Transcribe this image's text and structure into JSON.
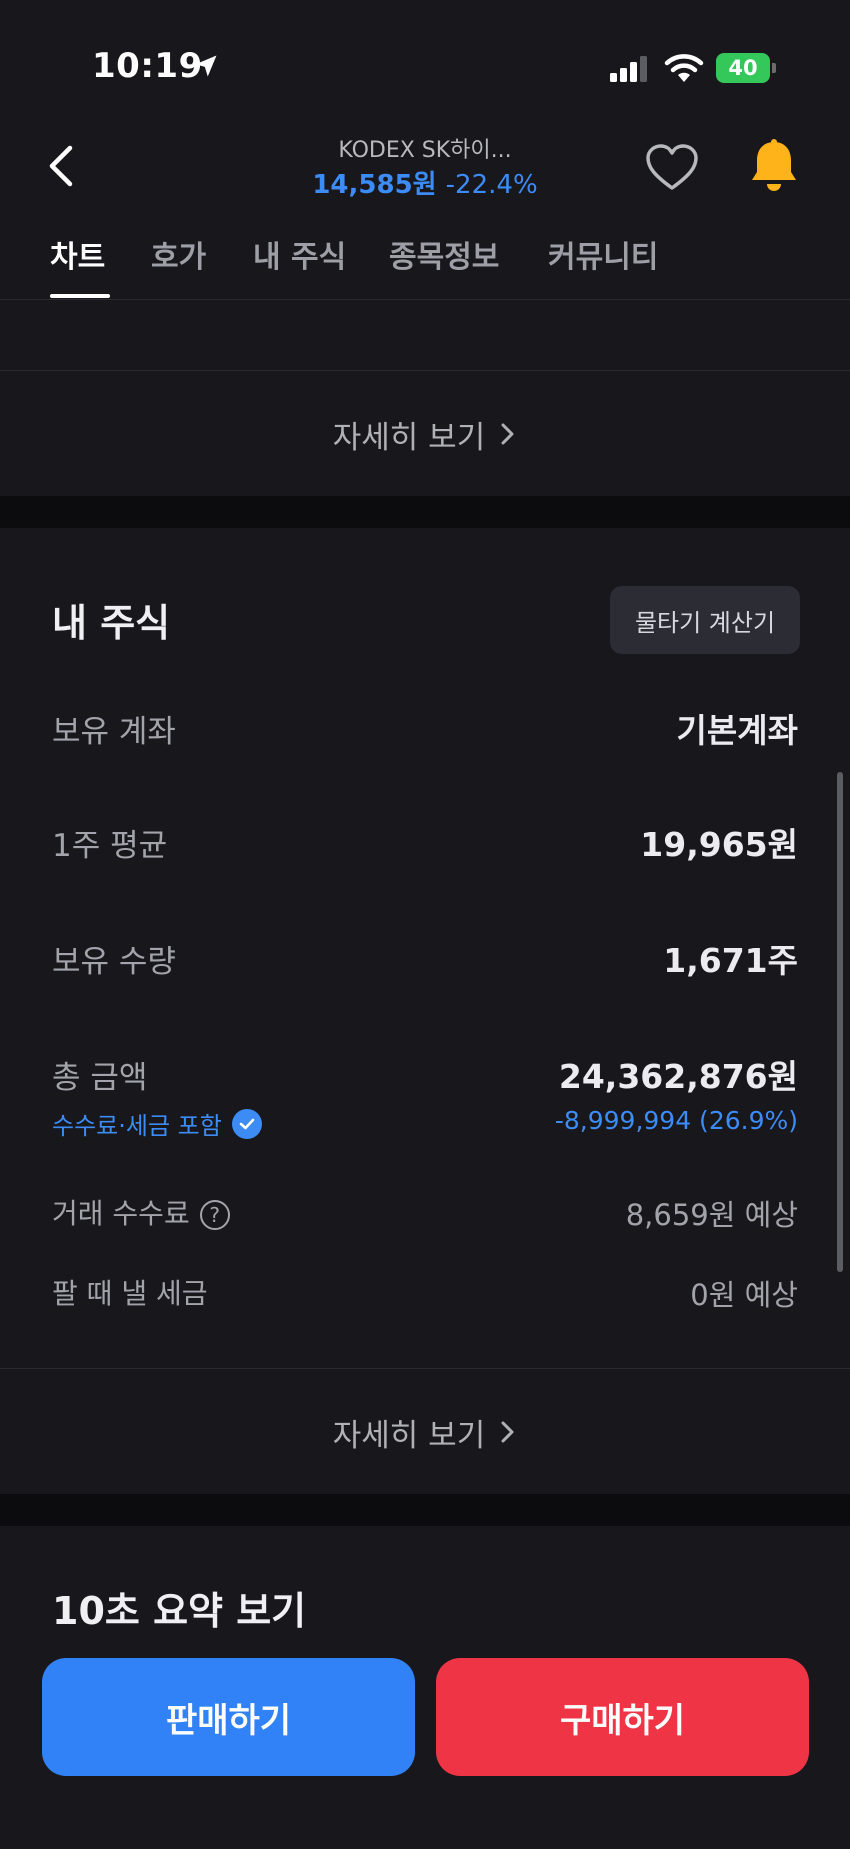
{
  "status_bar": {
    "time": "10:19",
    "battery": "40"
  },
  "header": {
    "stock_name": "KODEX SK하이...",
    "price": "14,585원",
    "change": "-22.4%"
  },
  "tabs": [
    "차트",
    "호가",
    "내 주식",
    "종목정보",
    "커뮤니티"
  ],
  "active_tab": 0,
  "upper_section": {
    "more_label": "자세히 보기"
  },
  "my_stock": {
    "title": "내 주식",
    "calc_button": "물타기 계산기",
    "account_label": "보유 계좌",
    "account_value": "기본계좌",
    "avg_label": "1주 평균",
    "avg_value": "19,965원",
    "qty_label": "보유 수량",
    "qty_value": "1,671주",
    "total_label": "총 금액",
    "total_value": "24,362,876원",
    "fee_tag": "수수료·세금 포함",
    "pl_value": "-8,999,994 (26.9%)",
    "fee_label": "거래 수수료",
    "fee_value": "8,659원 예상",
    "tax_label": "팔 때 낼 세금",
    "tax_value": "0원 예상",
    "more_label": "자세히 보기"
  },
  "summary": {
    "title": "10초 요약 보기"
  },
  "actions": {
    "sell": "판매하기",
    "buy": "구매하기"
  },
  "colors": {
    "background": "#17171c",
    "accent_blue": "#3182f6",
    "accent_red": "#ef3445",
    "bell_yellow": "#ffb31a",
    "battery_green": "#34c759"
  },
  "icons": {
    "back": "chevron-left-icon",
    "favorite": "heart-icon",
    "alert": "bell-icon",
    "more": "chevron-right-icon",
    "help": "question-circle-icon",
    "check": "check-circle-icon"
  }
}
